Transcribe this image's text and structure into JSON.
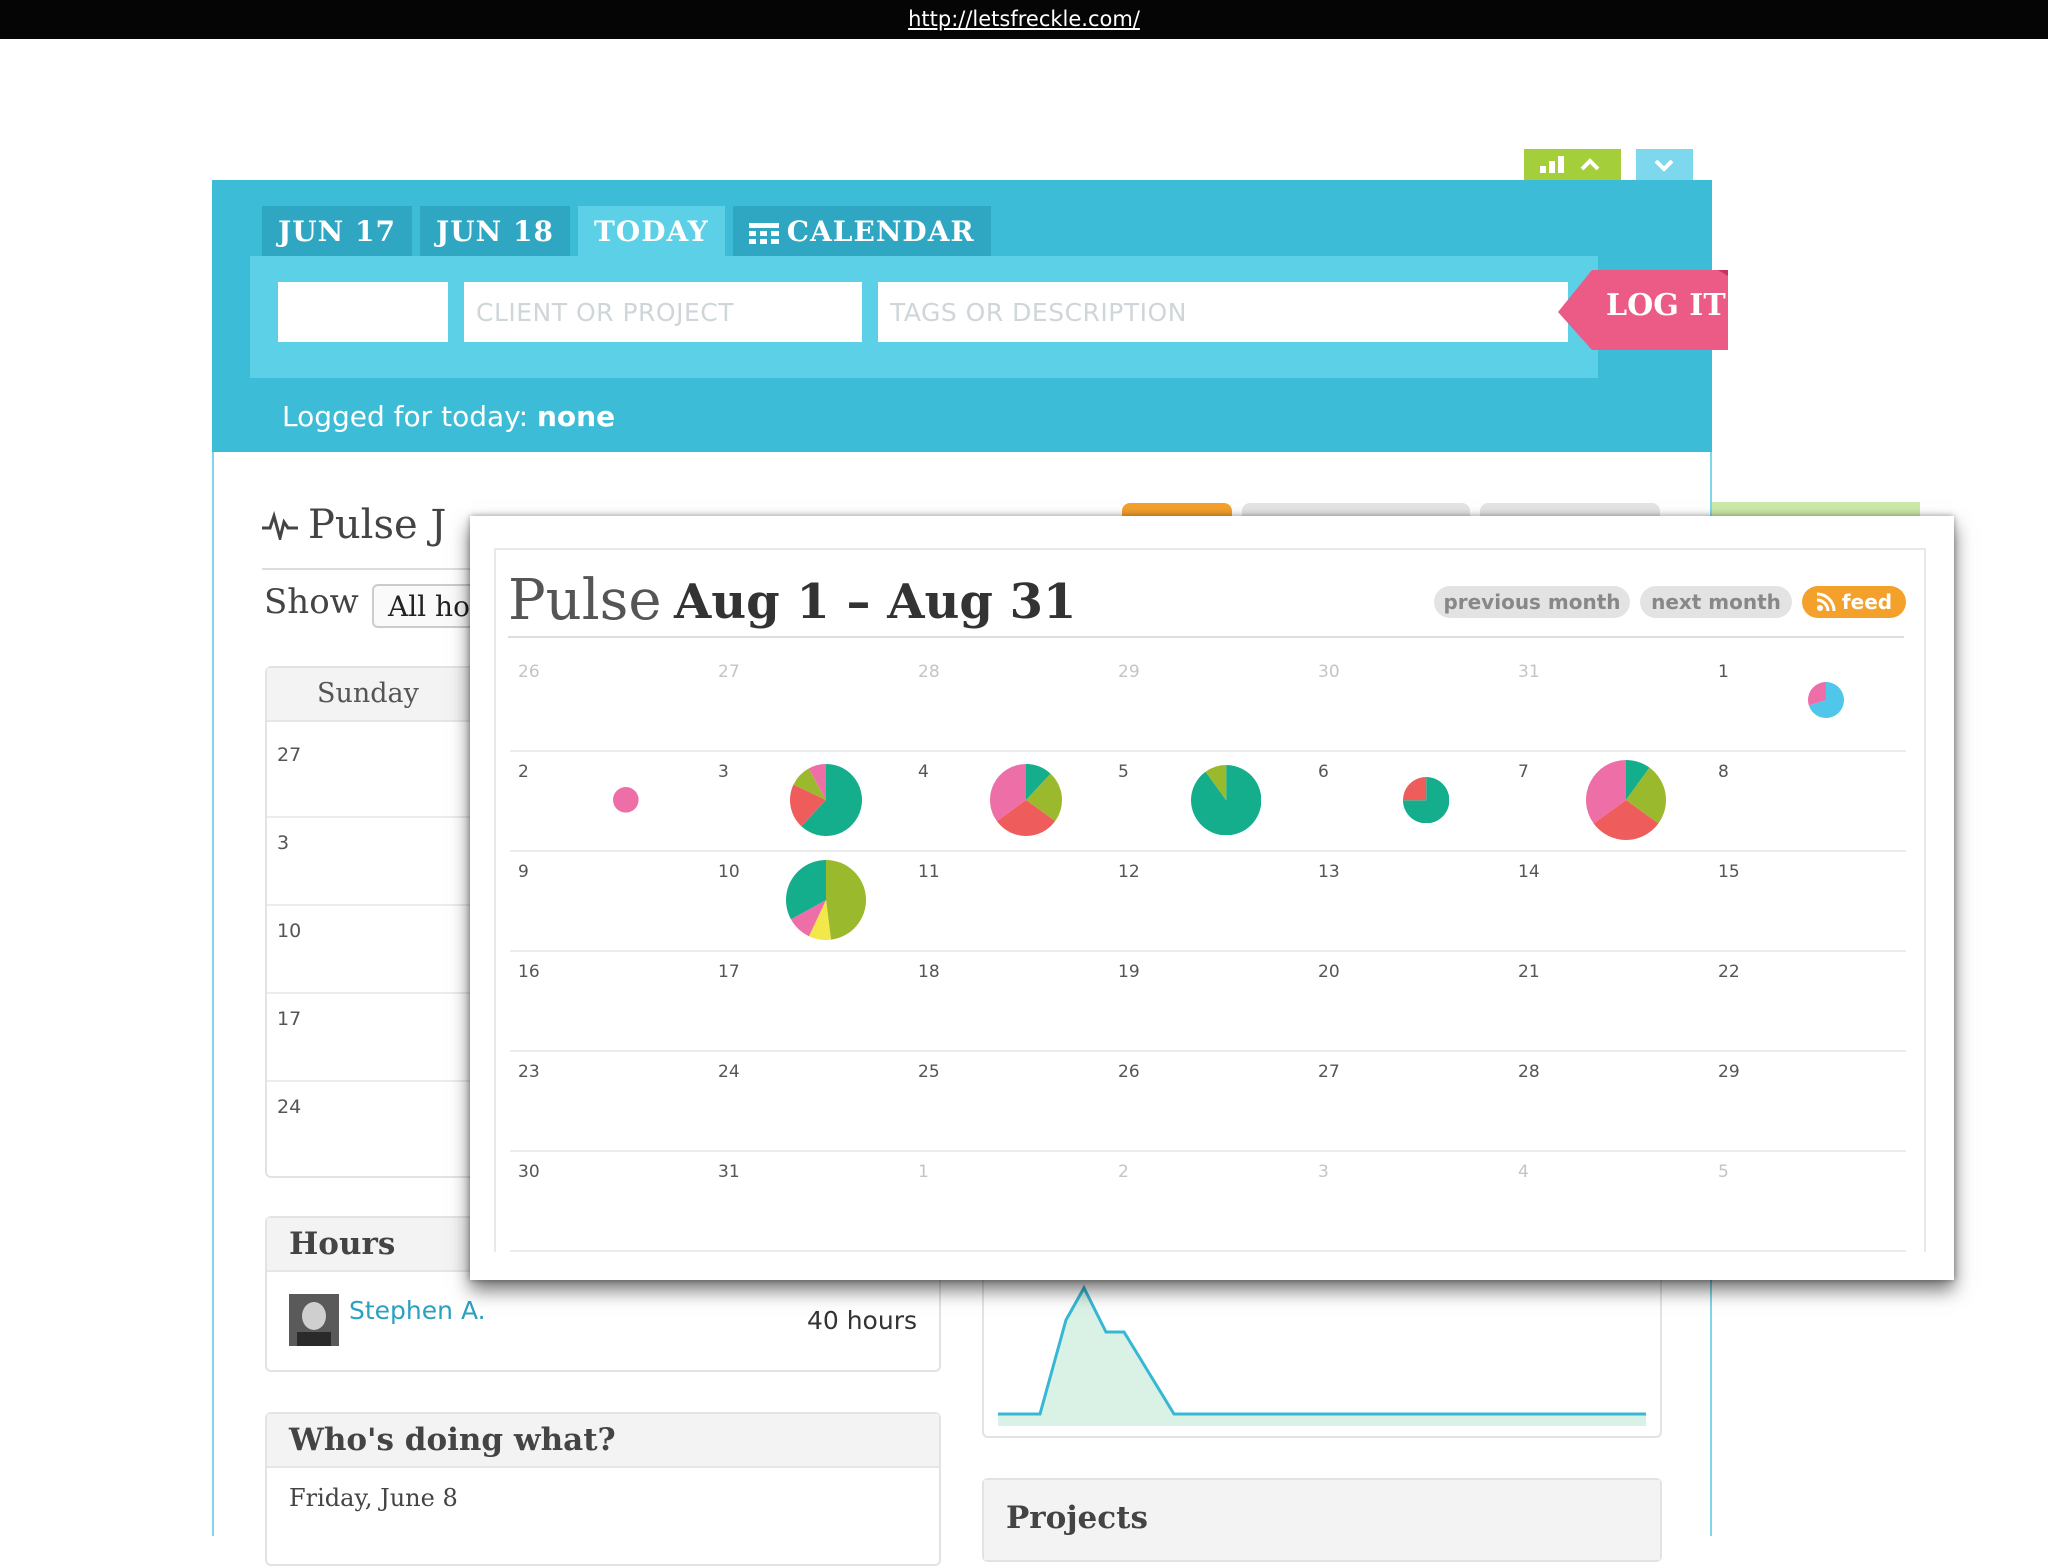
{
  "browser": {
    "url": "http://letsfreckle.com/"
  },
  "header": {
    "tabs": [
      {
        "label": "JUN 17",
        "active": false
      },
      {
        "label": "JUN 18",
        "active": false
      },
      {
        "label": "TODAY",
        "active": true
      },
      {
        "label": "CALENDAR",
        "active": false,
        "icon": "calendar-icon"
      }
    ],
    "entry": {
      "time_value": "",
      "project_placeholder": "CLIENT OR PROJECT",
      "description_placeholder": "TAGS OR DESCRIPTION",
      "log_label": "LOG IT"
    },
    "logged": {
      "prefix": "Logged for today:",
      "value": "none"
    }
  },
  "background": {
    "pulse_title": "Pulse J",
    "show_label": "Show",
    "show_select": "All ho",
    "calendar_header": "Sunday",
    "calendar_days": [
      "27",
      "3",
      "10",
      "17",
      "24"
    ],
    "hours": {
      "title": "Hours",
      "user": "Stephen A.",
      "value": "40 hours"
    },
    "who": {
      "title": "Who's doing what?",
      "date": "Friday, June 8"
    },
    "projects_title": "Projects"
  },
  "popup": {
    "title": "Pulse",
    "range": "Aug 1 – Aug 31",
    "prev_label": "previous month",
    "next_label": "next month",
    "feed_label": "feed",
    "colors": {
      "teal": "#14ae8c",
      "green": "#9bb92c",
      "pink": "#ee6fa8",
      "red": "#ef5c5c",
      "cyan": "#4fc6ea",
      "yellow": "#f2e84a"
    },
    "weeks": [
      [
        {
          "day": "26",
          "other": true
        },
        {
          "day": "27",
          "other": true
        },
        {
          "day": "28",
          "other": true
        },
        {
          "day": "29",
          "other": true
        },
        {
          "day": "30",
          "other": true
        },
        {
          "day": "31",
          "other": true
        },
        {
          "day": "1",
          "pie": {
            "size": 0.45,
            "slices": [
              {
                "color": "cyan",
                "value": 0.7
              },
              {
                "color": "pink",
                "value": 0.3
              }
            ]
          }
        }
      ],
      [
        {
          "day": "2",
          "pie": {
            "size": 0.32,
            "slices": [
              {
                "color": "pink",
                "value": 1
              }
            ]
          }
        },
        {
          "day": "3",
          "pie": {
            "size": 0.9,
            "slices": [
              {
                "color": "teal",
                "value": 0.62
              },
              {
                "color": "red",
                "value": 0.2
              },
              {
                "color": "green",
                "value": 0.1
              },
              {
                "color": "pink",
                "value": 0.08
              }
            ]
          }
        },
        {
          "day": "4",
          "pie": {
            "size": 0.9,
            "slices": [
              {
                "color": "teal",
                "value": 0.12
              },
              {
                "color": "green",
                "value": 0.23
              },
              {
                "color": "red",
                "value": 0.3
              },
              {
                "color": "pink",
                "value": 0.35
              }
            ]
          }
        },
        {
          "day": "5",
          "pie": {
            "size": 0.88,
            "slices": [
              {
                "color": "teal",
                "value": 0.9
              },
              {
                "color": "green",
                "value": 0.1
              }
            ]
          }
        },
        {
          "day": "6",
          "pie": {
            "size": 0.58,
            "slices": [
              {
                "color": "teal",
                "value": 0.75
              },
              {
                "color": "red",
                "value": 0.25
              }
            ]
          }
        },
        {
          "day": "7",
          "pie": {
            "size": 1.0,
            "slices": [
              {
                "color": "teal",
                "value": 0.1
              },
              {
                "color": "green",
                "value": 0.25
              },
              {
                "color": "red",
                "value": 0.3
              },
              {
                "color": "pink",
                "value": 0.35
              }
            ]
          }
        },
        {
          "day": "8"
        }
      ],
      [
        {
          "day": "9"
        },
        {
          "day": "10",
          "pie": {
            "size": 1.0,
            "slices": [
              {
                "color": "green",
                "value": 0.48
              },
              {
                "color": "yellow",
                "value": 0.09
              },
              {
                "color": "pink",
                "value": 0.1
              },
              {
                "color": "teal",
                "value": 0.33
              }
            ]
          }
        },
        {
          "day": "11"
        },
        {
          "day": "12"
        },
        {
          "day": "13"
        },
        {
          "day": "14"
        },
        {
          "day": "15"
        }
      ],
      [
        {
          "day": "16"
        },
        {
          "day": "17"
        },
        {
          "day": "18"
        },
        {
          "day": "19"
        },
        {
          "day": "20"
        },
        {
          "day": "21"
        },
        {
          "day": "22"
        }
      ],
      [
        {
          "day": "23"
        },
        {
          "day": "24"
        },
        {
          "day": "25"
        },
        {
          "day": "26"
        },
        {
          "day": "27"
        },
        {
          "day": "28"
        },
        {
          "day": "29"
        }
      ],
      [
        {
          "day": "30"
        },
        {
          "day": "31"
        },
        {
          "day": "1",
          "other": true
        },
        {
          "day": "2",
          "other": true
        },
        {
          "day": "3",
          "other": true
        },
        {
          "day": "4",
          "other": true
        },
        {
          "day": "5",
          "other": true
        }
      ]
    ]
  }
}
